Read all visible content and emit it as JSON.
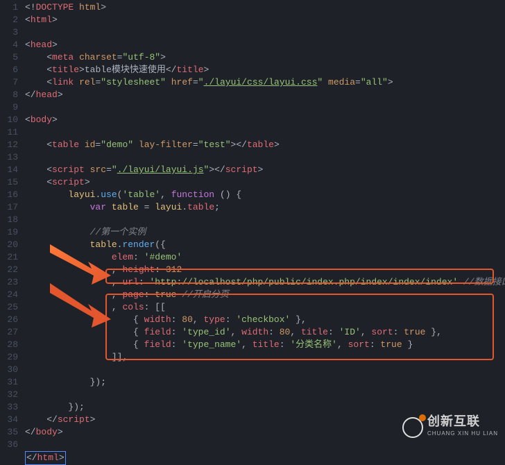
{
  "code": {
    "lines": [
      "<!DOCTYPE html>",
      "<html>",
      "",
      "<head>",
      "    <meta charset=\"utf-8\">",
      "    <title>table模块快速使用</title>",
      "    <link rel=\"stylesheet\" href=\"./layui/css/layui.css\" media=\"all\">",
      "</head>",
      "",
      "<body>",
      "",
      "    <table id=\"demo\" lay-filter=\"test\"></table>",
      "",
      "    <script src=\"./layui/layui.js\"></script>",
      "    <script>",
      "        layui.use('table', function () {",
      "            var table = layui.table;",
      "",
      "            //第一个实例",
      "            table.render({",
      "                elem: '#demo'",
      "                , height: 312",
      "                , url: 'http://localhost/php/public/index.php/index/index/index' //数据接口",
      "                , page: true //开启分页",
      "                , cols: [[",
      "                    { width: 80, type: 'checkbox' },",
      "                    { field: 'type_id', width: 80, title: 'ID', sort: true },",
      "                    { field: 'type_name', title: '分类名称', sort: true }",
      "                ]],",
      "",
      "            });",
      "",
      "        });",
      "    </script>",
      "</body>",
      "",
      "</html>"
    ],
    "title_text": "table模块快速使用",
    "stylesheet_href": "./layui/css/layui.css",
    "script_src": "./layui/layui.js",
    "comment_first": "//第一个实例",
    "comment_data_api": "//数据接口",
    "comment_paging": "//开启分页",
    "elem_value": "#demo",
    "height_value": "312",
    "url_value": "http://localhost/php/public/index.php/index/index/index",
    "checkbox_width": "80",
    "checkbox_type": "checkbox",
    "col1_field": "type_id",
    "col1_width": "80",
    "col1_title": "ID",
    "col2_field": "type_name",
    "col2_title": "分类名称"
  },
  "watermark": {
    "main": "创新互联",
    "sub": "CHUANG XIN HU LIAN"
  }
}
